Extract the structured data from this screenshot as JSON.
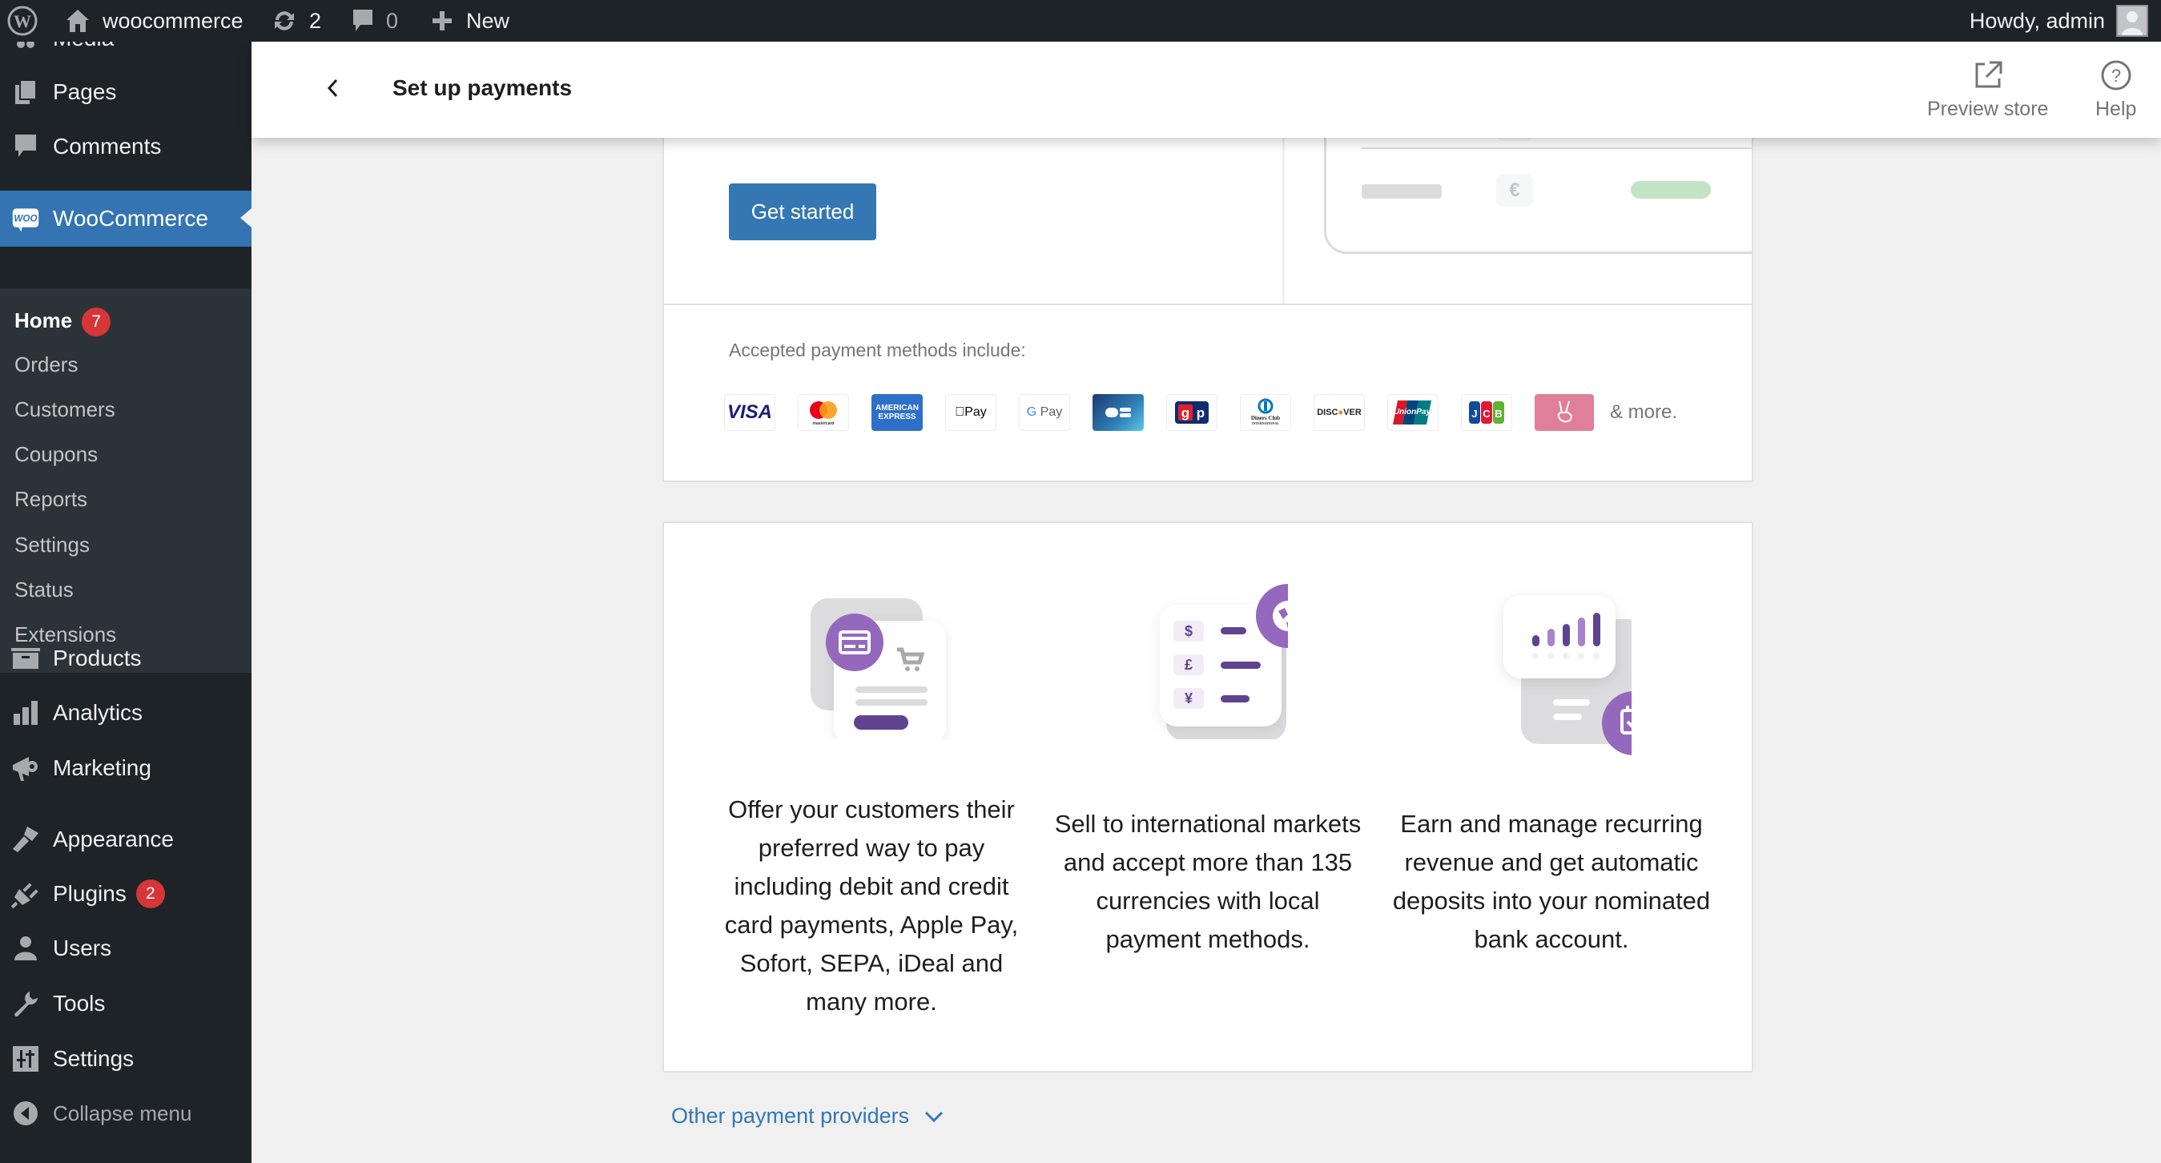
{
  "adminbar": {
    "site_name": "woocommerce",
    "updates_count": "2",
    "comments_count": "0",
    "new_label": "New",
    "greeting": "Howdy, admin"
  },
  "sidebar": {
    "top_partial": "Media",
    "items_top": [
      {
        "label": "Pages",
        "icon": "pages-icon"
      },
      {
        "label": "Comments",
        "icon": "comments-icon"
      }
    ],
    "woocommerce": {
      "label": "WooCommerce",
      "icon": "woo-icon"
    },
    "submenu": [
      {
        "label": "Home",
        "badge": "7",
        "current": true
      },
      {
        "label": "Orders"
      },
      {
        "label": "Customers"
      },
      {
        "label": "Coupons"
      },
      {
        "label": "Reports"
      },
      {
        "label": "Settings"
      },
      {
        "label": "Status"
      },
      {
        "label": "Extensions"
      }
    ],
    "items_bottom": [
      {
        "label": "Products",
        "icon": "products-icon"
      },
      {
        "label": "Analytics",
        "icon": "analytics-icon"
      },
      {
        "label": "Marketing",
        "icon": "marketing-icon"
      },
      {
        "label": "Appearance",
        "icon": "appearance-icon"
      },
      {
        "label": "Plugins",
        "icon": "plugins-icon",
        "badge": "2"
      },
      {
        "label": "Users",
        "icon": "users-icon"
      },
      {
        "label": "Tools",
        "icon": "tools-icon"
      },
      {
        "label": "Settings",
        "icon": "settings-icon"
      }
    ],
    "collapse_label": "Collapse menu"
  },
  "header": {
    "title": "Set up payments",
    "preview_label": "Preview store",
    "help_label": "Help"
  },
  "setup_card": {
    "cta_label": "Get started",
    "illustration_currencies": [
      "$",
      "€"
    ],
    "accepted_label": "Accepted payment methods include:",
    "methods": [
      "Visa",
      "Mastercard",
      "American Express",
      "Apple Pay",
      "Google Pay",
      "Cartes Bancaires",
      "giropay",
      "Diners Club International",
      "Discover",
      "UnionPay",
      "JCB",
      "Sofort"
    ],
    "more_label": "& more."
  },
  "features": [
    {
      "icon": "credit-card-icon",
      "text": "Offer your customers their preferred way to pay including debit and credit card payments, Apple Pay, Sofort, SEPA, iDeal and many more."
    },
    {
      "icon": "globe-icon",
      "currencies": [
        "$",
        "£",
        "¥"
      ],
      "text": "Sell to international markets and accept more than 135 currencies with local payment methods."
    },
    {
      "icon": "calendar-check-icon",
      "text": "Earn and manage recurring revenue and get automatic deposits into your nominated bank account."
    }
  ],
  "other_providers_label": "Other payment providers",
  "colors": {
    "admin_dark": "#1d2327",
    "accent_blue": "#3477b3",
    "woo_purple": "#9469bd",
    "woo_purple_dark": "#5f438f",
    "badge_red": "#d63638"
  }
}
